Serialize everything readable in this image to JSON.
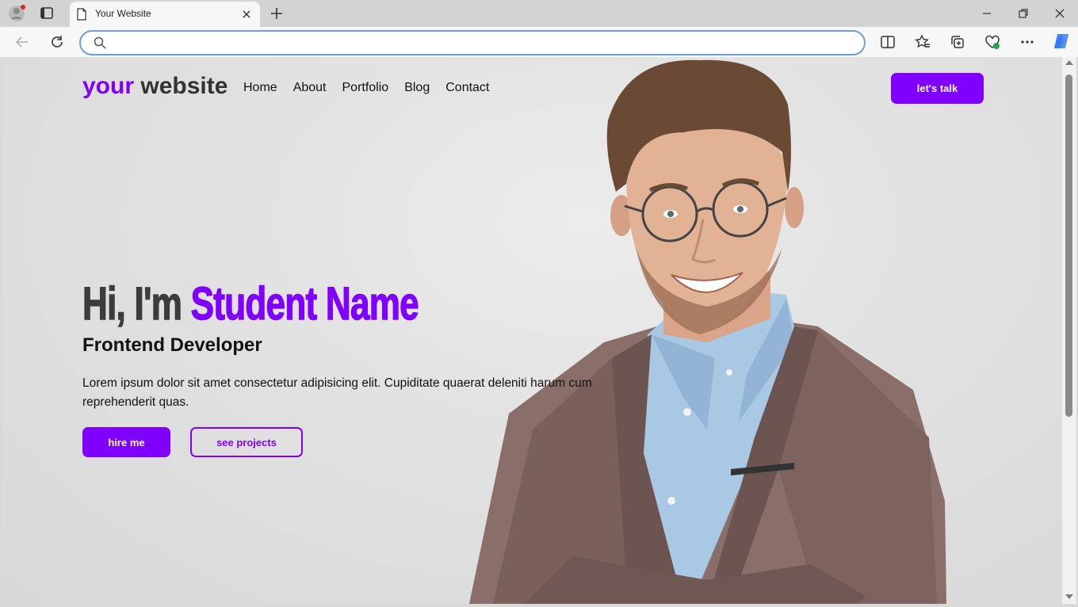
{
  "browser": {
    "tab_title": "Your Website",
    "address_value": "",
    "accent_color": "#6d9edc"
  },
  "site": {
    "logo_part1": "your",
    "logo_part2": "website",
    "nav": [
      {
        "label": "Home"
      },
      {
        "label": "About"
      },
      {
        "label": "Portfolio"
      },
      {
        "label": "Blog"
      },
      {
        "label": "Contact"
      }
    ],
    "cta_label": "let's talk",
    "brand_color": "#8000ff"
  },
  "hero": {
    "greeting": "Hi, I'm ",
    "name": "Student Name",
    "role": "Frontend Developer",
    "description": "Lorem ipsum dolor sit amet consectetur adipisicing elit. Cupiditate quaerat deleniti harum cum reprehenderit quas.",
    "primary_button": "hire me",
    "secondary_button": "see projects",
    "image_subject": "smiling-man-portrait"
  }
}
